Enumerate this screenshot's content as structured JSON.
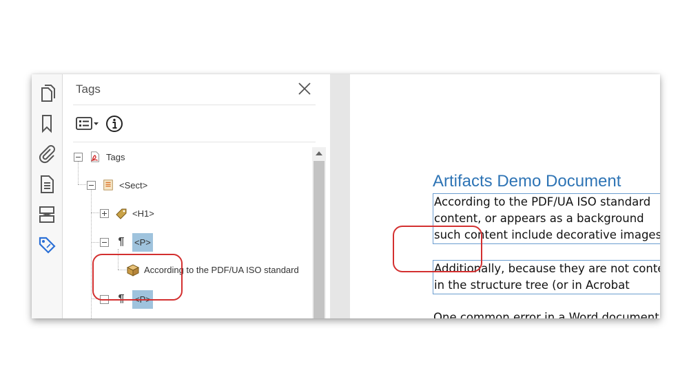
{
  "panel": {
    "title": "Tags"
  },
  "toolbar": {
    "icons": [
      "page-thumbnails-icon",
      "bookmarks-icon",
      "attachments-icon",
      "content-icon",
      "order-icon",
      "tags-icon"
    ]
  },
  "tree": {
    "root": "Tags",
    "sect": "<Sect>",
    "h1": "<H1>",
    "p1": "<P>",
    "content": "According to the PDF/UA ISO standard",
    "p2": "<P>"
  },
  "document": {
    "title": "Artifacts Demo Document",
    "para1_lines": [
      "According to the PDF/UA ISO standard",
      "content, or appears as a background",
      "such content include decorative images"
    ],
    "para2_lines": [
      "Additionally, because they are not content",
      "in the structure tree (or in Acrobat"
    ],
    "para3": "One common error in a Word document"
  },
  "colors": {
    "title_blue": "#2e74b5",
    "selection": "#9fc3dd",
    "annotation_red": "#d32f2f",
    "para_border": "#6a9ccf"
  }
}
